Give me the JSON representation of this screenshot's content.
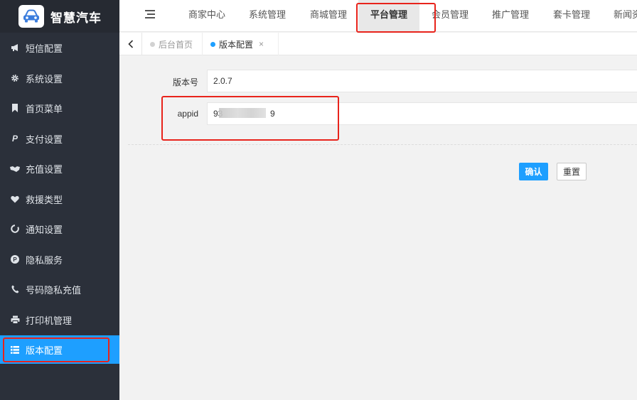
{
  "brand": {
    "name": "智慧汽车",
    "logo_icon": "car-icon"
  },
  "sidebar": {
    "items": [
      {
        "label": "短信配置",
        "icon": "megaphone-icon",
        "active": false
      },
      {
        "label": "系统设置",
        "icon": "gear-icon",
        "active": false
      },
      {
        "label": "首页菜单",
        "icon": "bookmark-icon",
        "active": false
      },
      {
        "label": "支付设置",
        "icon": "paypal-icon",
        "active": false
      },
      {
        "label": "充值设置",
        "icon": "handshake-icon",
        "active": false
      },
      {
        "label": "救援类型",
        "icon": "heart-icon",
        "active": false
      },
      {
        "label": "通知设置",
        "icon": "circle-notch-icon",
        "active": false
      },
      {
        "label": "隐私服务",
        "icon": "p-circle-icon",
        "active": false
      },
      {
        "label": "号码隐私充值",
        "icon": "phone-icon",
        "active": false
      },
      {
        "label": "打印机管理",
        "icon": "printer-icon",
        "active": false
      },
      {
        "label": "版本配置",
        "icon": "list-icon",
        "active": true
      }
    ]
  },
  "header": {
    "menu_icon": "menu-fold-icon",
    "tabs": [
      {
        "label": "商家中心",
        "active": false
      },
      {
        "label": "系统管理",
        "active": false
      },
      {
        "label": "商城管理",
        "active": false
      },
      {
        "label": "平台管理",
        "active": true
      },
      {
        "label": "会员管理",
        "active": false
      },
      {
        "label": "推广管理",
        "active": false
      },
      {
        "label": "套卡管理",
        "active": false
      },
      {
        "label": "新闻资",
        "active": false
      }
    ]
  },
  "tabstrip": {
    "back_icon": "chevron-left-icon",
    "tabs": [
      {
        "label": "后台首页",
        "current": false
      },
      {
        "label": "版本配置",
        "current": true,
        "close": "×"
      }
    ]
  },
  "form": {
    "version": {
      "label": "版本号",
      "value": "2.0.7"
    },
    "appid": {
      "label": "appid",
      "value": "93                    9"
    },
    "confirm_label": "确认",
    "reset_label": "重置"
  },
  "colors": {
    "accent": "#1e9fff",
    "sidebar_bg": "#2b303a",
    "highlight": "#e8231b"
  }
}
